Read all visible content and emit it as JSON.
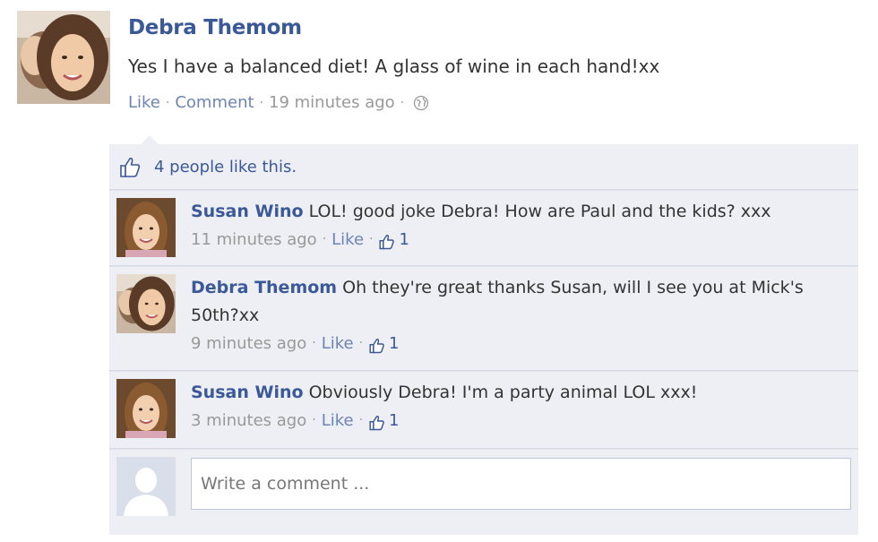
{
  "post": {
    "author": "Debra Themom",
    "text": "Yes I have a balanced diet! A glass of wine in each hand!xx",
    "like_label": "Like",
    "comment_label": "Comment",
    "time": "19 minutes ago",
    "privacy_icon": "globe-icon"
  },
  "likes": {
    "text": "4 people like this."
  },
  "comments": [
    {
      "author": "Susan Wino",
      "text": "LOL! good joke Debra! How are Paul and the kids? xxx",
      "time": "11 minutes ago",
      "like_label": "Like",
      "like_count": "1"
    },
    {
      "author": "Debra Themom",
      "text": "Oh they're great thanks Susan, will I see you at Mick's 50th?xx",
      "time": "9 minutes ago",
      "like_label": "Like",
      "like_count": "1"
    },
    {
      "author": "Susan Wino",
      "text": "Obviously Debra! I'm a party animal LOL xxx!",
      "time": "3 minutes ago",
      "like_label": "Like",
      "like_count": "1"
    }
  ],
  "composer": {
    "placeholder": "Write a comment ..."
  },
  "colors": {
    "link": "#3b5998",
    "meta_link": "#6d84b4",
    "comments_bg": "#edeff4"
  }
}
